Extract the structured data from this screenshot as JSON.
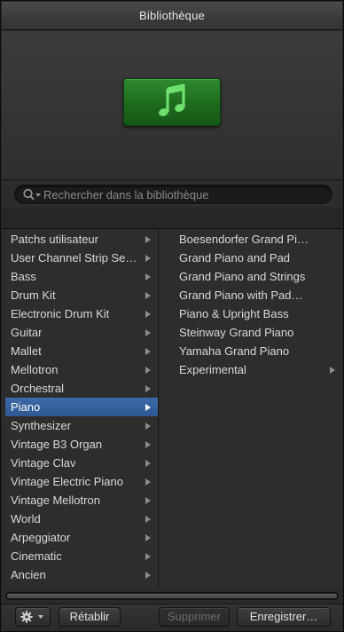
{
  "window": {
    "title": "Bibliothèque"
  },
  "preview": {
    "icon": "music-note-icon",
    "icon_color": "#2e8a2e"
  },
  "search": {
    "placeholder": "Rechercher dans la bibliothèque",
    "value": ""
  },
  "categories": [
    {
      "label": "Patchs utilisateur",
      "has_submenu": true
    },
    {
      "label": "User Channel Strip Se…",
      "has_submenu": true
    },
    {
      "label": "Bass",
      "has_submenu": true
    },
    {
      "label": "Drum Kit",
      "has_submenu": true
    },
    {
      "label": "Electronic Drum Kit",
      "has_submenu": true
    },
    {
      "label": "Guitar",
      "has_submenu": true
    },
    {
      "label": "Mallet",
      "has_submenu": true
    },
    {
      "label": "Mellotron",
      "has_submenu": true
    },
    {
      "label": "Orchestral",
      "has_submenu": true
    },
    {
      "label": "Piano",
      "has_submenu": true,
      "selected": true
    },
    {
      "label": "Synthesizer",
      "has_submenu": true
    },
    {
      "label": "Vintage B3 Organ",
      "has_submenu": true
    },
    {
      "label": "Vintage Clav",
      "has_submenu": true
    },
    {
      "label": "Vintage Electric Piano",
      "has_submenu": true
    },
    {
      "label": "Vintage Mellotron",
      "has_submenu": true
    },
    {
      "label": "World",
      "has_submenu": true
    },
    {
      "label": "Arpeggiator",
      "has_submenu": true
    },
    {
      "label": "Cinematic",
      "has_submenu": true
    },
    {
      "label": "Ancien",
      "has_submenu": true
    }
  ],
  "patches": [
    {
      "label": "Boesendorfer Grand Piano",
      "has_submenu": false
    },
    {
      "label": "Grand Piano and Pad",
      "has_submenu": false
    },
    {
      "label": "Grand Piano and Strings",
      "has_submenu": false
    },
    {
      "label": "Grand Piano with Pad…",
      "has_submenu": false
    },
    {
      "label": "Piano & Upright Bass",
      "has_submenu": false
    },
    {
      "label": "Steinway Grand Piano",
      "has_submenu": false
    },
    {
      "label": "Yamaha Grand Piano",
      "has_submenu": false
    },
    {
      "label": "Experimental",
      "has_submenu": true
    }
  ],
  "footer": {
    "gear_icon": "gear-icon",
    "revert_label": "Rétablir",
    "delete_label": "Supprimer",
    "save_label": "Enregistrer…",
    "delete_enabled": false
  },
  "colors": {
    "selection": "#3d6aa8",
    "background": "#2d2d2d"
  }
}
